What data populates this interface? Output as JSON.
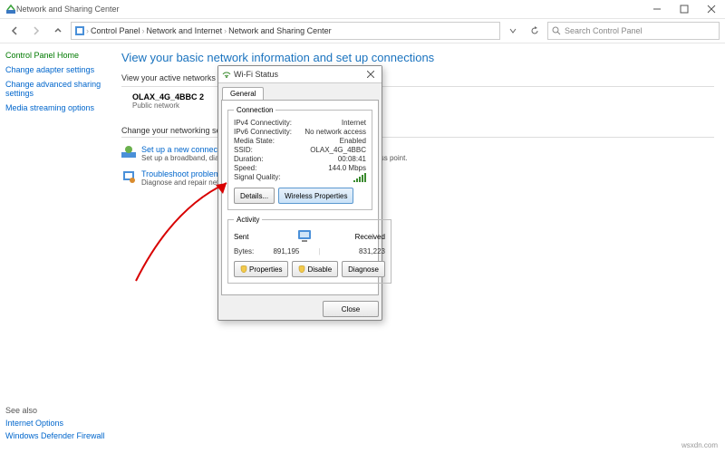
{
  "window": {
    "title": "Network and Sharing Center",
    "breadcrumb": [
      "Control Panel",
      "Network and Internet",
      "Network and Sharing Center"
    ],
    "search_placeholder": "Search Control Panel"
  },
  "sidebar": {
    "heading": "Control Panel Home",
    "items": [
      "Change adapter settings",
      "Change advanced sharing settings",
      "Media streaming options"
    ]
  },
  "main": {
    "heading": "View your basic network information and set up connections",
    "view_label": "View your active networks",
    "network_name": "OLAX_4G_4BBC 2",
    "network_type": "Public network",
    "change_label": "Change your networking settings",
    "task_setup_title": "Set up a new connection or network",
    "task_setup_desc": "Set up a broadband, dial-up, or VPN connection; or set up a router or access point.",
    "task_trouble_title": "Troubleshoot problems",
    "task_trouble_desc": "Diagnose and repair network problems, or get troubleshooting information."
  },
  "see_also": {
    "heading": "See also",
    "items": [
      "Internet Options",
      "Windows Defender Firewall"
    ]
  },
  "dialog": {
    "title": "Wi-Fi Status",
    "tab": "General",
    "connection_legend": "Connection",
    "rows": {
      "ipv4_l": "IPv4 Connectivity:",
      "ipv4_v": "Internet",
      "ipv6_l": "IPv6 Connectivity:",
      "ipv6_v": "No network access",
      "media_l": "Media State:",
      "media_v": "Enabled",
      "ssid_l": "SSID:",
      "ssid_v": "OLAX_4G_4BBC",
      "dur_l": "Duration:",
      "dur_v": "00:08:41",
      "speed_l": "Speed:",
      "speed_v": "144.0 Mbps",
      "signal_l": "Signal Quality:"
    },
    "details_btn": "Details...",
    "wireless_btn": "Wireless Properties",
    "activity_legend": "Activity",
    "sent_label": "Sent",
    "received_label": "Received",
    "bytes_label": "Bytes:",
    "bytes_sent": "891,195",
    "bytes_recv": "831,223",
    "properties_btn": "Properties",
    "disable_btn": "Disable",
    "diagnose_btn": "Diagnose",
    "close_btn": "Close"
  },
  "watermark": "wsxdn.com"
}
